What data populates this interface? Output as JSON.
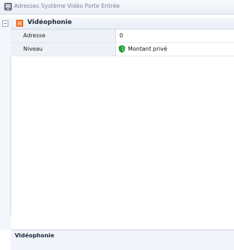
{
  "window": {
    "title": "Adresses Système Vidéo Porte Entrée"
  },
  "grid": {
    "collapse_glyph": "−",
    "category": {
      "label": "Vidéophonie",
      "icon": "orange-square-icon"
    },
    "rows": [
      {
        "name": "Adresse",
        "value": "0"
      },
      {
        "name": "Niveau",
        "value": "Montant privé",
        "icon": "green-shield-icon"
      }
    ]
  },
  "description": {
    "title": "Vidéophonie"
  },
  "colors": {
    "accent": "#f26a1b",
    "shield": "#2e9a3a",
    "category_bg": "#e8eef6",
    "name_col_bg": "#eef2f7"
  }
}
